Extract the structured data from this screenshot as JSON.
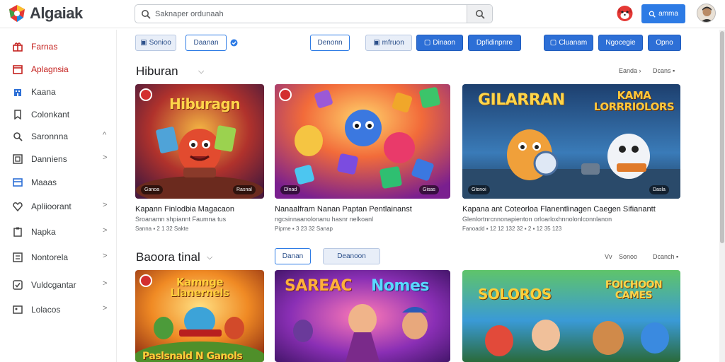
{
  "app": {
    "name": "Algaiak"
  },
  "search": {
    "placeholder": "Saknaper ordunaah"
  },
  "topbar": {
    "button_label": "amma",
    "accent": "#2d7be5"
  },
  "sidebar": {
    "items": [
      {
        "label": "Farnas",
        "icon": "gift-icon",
        "chevron": ""
      },
      {
        "label": "Aplagnsia",
        "icon": "calendar-icon",
        "chevron": ""
      },
      {
        "label": "Kaana",
        "icon": "building-icon",
        "chevron": ""
      },
      {
        "label": "Colonkant",
        "icon": "bookmark-icon",
        "chevron": ""
      },
      {
        "label": "Saronnna",
        "icon": "search-icon",
        "chevron": "^"
      },
      {
        "label": "Danniens",
        "icon": "grid-icon",
        "chevron": ">"
      },
      {
        "label": "Maaas",
        "icon": "card-icon",
        "chevron": ""
      },
      {
        "label": "Apliioorant",
        "icon": "heart-icon",
        "chevron": ">"
      },
      {
        "label": "Napka",
        "icon": "clipboard-icon",
        "chevron": ">"
      },
      {
        "label": "Nontorela",
        "icon": "list-icon",
        "chevron": ">"
      },
      {
        "label": "Vuldcgantar",
        "icon": "check-icon",
        "chevron": ">"
      },
      {
        "label": "Lolacos",
        "icon": "image-icon",
        "chevron": ">"
      }
    ]
  },
  "chips": [
    {
      "label": "Sonioo",
      "style": "light"
    },
    {
      "label": "Daanan",
      "style": "outline"
    },
    {
      "label": "Denonn",
      "style": "outline"
    },
    {
      "label": "mfruon",
      "style": "light"
    },
    {
      "label": "Dinaon",
      "style": "blue"
    },
    {
      "label": "Dpfidinpnre",
      "style": "blue"
    },
    {
      "label": "Cluanam",
      "style": "blue"
    },
    {
      "label": "Ngocegie",
      "style": "blue"
    },
    {
      "label": "Opno",
      "style": "blue"
    }
  ],
  "section1": {
    "title": "Hiburan",
    "right_a": "Eanda ›",
    "right_b": "Dcans ▪",
    "cards": [
      {
        "art_title": "Hiburagn",
        "badge_left": "Ganoa",
        "badge_right": "Rasnal",
        "title": "Kapann Finlodbia Magacaon",
        "sub": "Sroanamn shpiannt Faumna tus",
        "meta": "Sanna ▪ 2 1 32 Sakte"
      },
      {
        "art_title": "",
        "badge_left": "Dlnad",
        "badge_right": "Gisas",
        "title": "Nanaalfram Nanan Paptan Pentlainanst",
        "sub": "ngcsinnaanolonanu hasnr nelkoanl",
        "meta": "Pipme ▪ 3 23 32 Sanap"
      },
      {
        "art_title": "GILARRAN",
        "art_title2": "KAMA LORRRIOLORS",
        "badge_left": "Gtonoi",
        "badge_right": "Dasla",
        "title": "Kapana ant Coteorloa Flanentlinagen Caegen Sifianantt",
        "sub": "Glenlortnrcnnonapienton orloarloxhnnolonlconnlanon",
        "meta": "Fanoadd ▪ 12 12 132 32 ▪ 2 ▪ 12 35 123"
      }
    ]
  },
  "section2": {
    "title": "Baoora tinal",
    "tabs": [
      "Danan",
      "Deanoon"
    ],
    "right_a": "Sonoo",
    "right_b": "Dcanch ▪",
    "right_icon": "Vv",
    "cards": [
      {
        "art_title": "Kamnge Llanernels",
        "art_title2": "Paslsnald N Ganols"
      },
      {
        "art_title": "SAREAC",
        "art_title2": "Nomes"
      },
      {
        "art_title": "SOLOROS",
        "art_title2": "FOICHOON CAMES"
      }
    ]
  }
}
